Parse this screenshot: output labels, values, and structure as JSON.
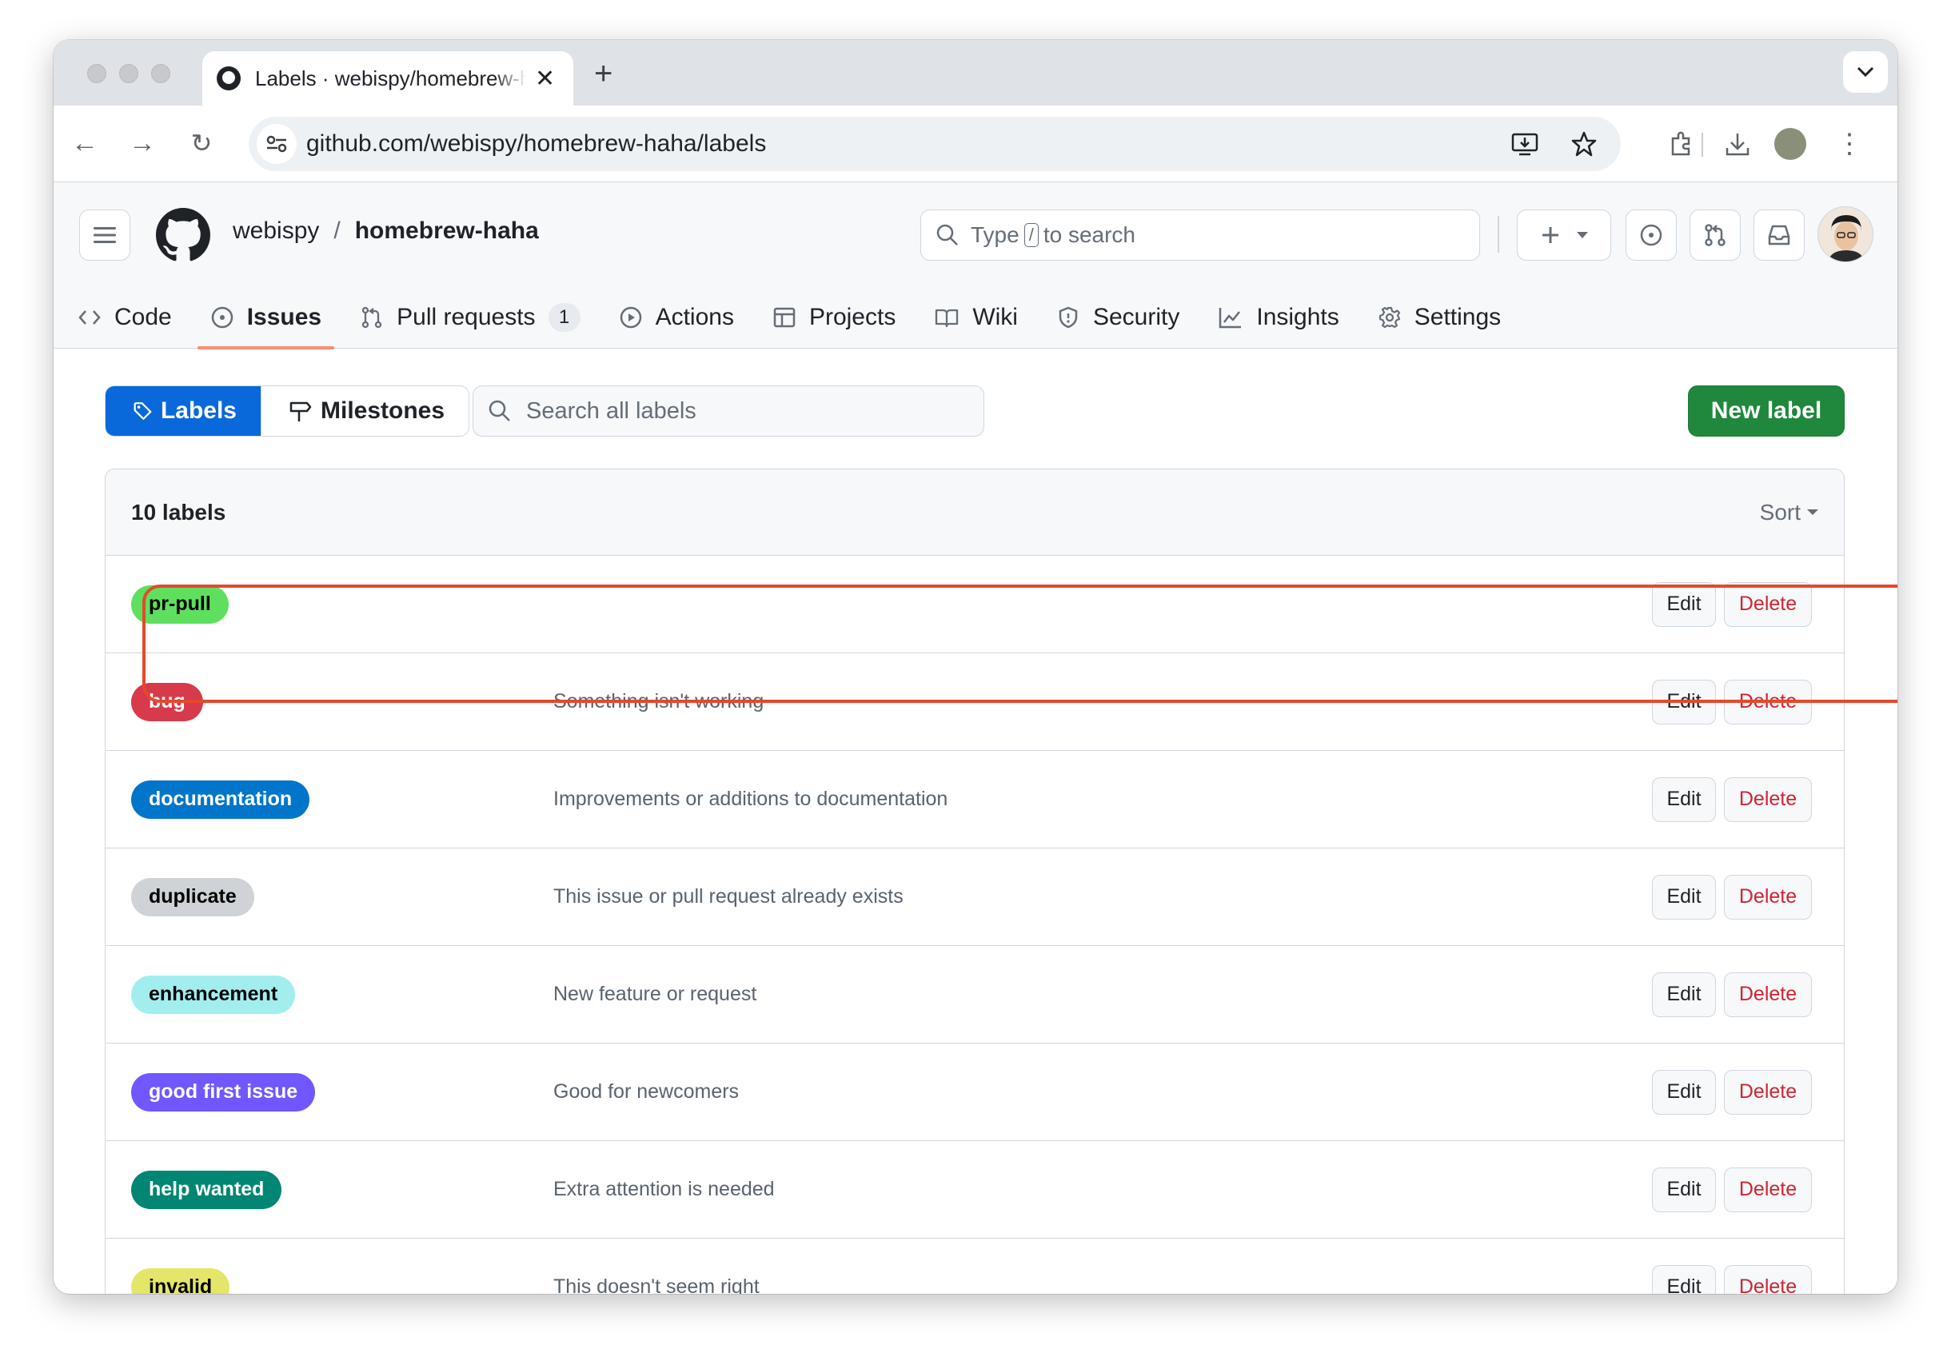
{
  "browser": {
    "tab_title": "Labels · webispy/homebrew-haha",
    "url": "github.com/webispy/homebrew-haha/labels"
  },
  "header": {
    "owner": "webispy",
    "separator": "/",
    "repo": "homebrew-haha",
    "search_prefix": "Type",
    "search_key": "/",
    "search_suffix": "to search"
  },
  "repo_nav": [
    {
      "label": "Code",
      "icon": "code-icon"
    },
    {
      "label": "Issues",
      "icon": "issue-icon",
      "selected": true
    },
    {
      "label": "Pull requests",
      "icon": "pull-request-icon",
      "count": "1"
    },
    {
      "label": "Actions",
      "icon": "play-icon"
    },
    {
      "label": "Projects",
      "icon": "table-icon"
    },
    {
      "label": "Wiki",
      "icon": "book-icon"
    },
    {
      "label": "Security",
      "icon": "shield-icon"
    },
    {
      "label": "Insights",
      "icon": "graph-icon"
    },
    {
      "label": "Settings",
      "icon": "gear-icon"
    }
  ],
  "subnav": {
    "labels": "Labels",
    "milestones": "Milestones",
    "search_placeholder": "Search all labels",
    "new_label": "New label"
  },
  "labels_box": {
    "count": "10 labels",
    "sort": "Sort",
    "edit": "Edit",
    "delete": "Delete",
    "rows": [
      {
        "name": "pr-pull",
        "description": "",
        "bg": "#5ee05e",
        "fg": "#000000"
      },
      {
        "name": "bug",
        "description": "Something isn't working",
        "bg": "#d73a4a",
        "fg": "#ffffff"
      },
      {
        "name": "documentation",
        "description": "Improvements or additions to documentation",
        "bg": "#0075ca",
        "fg": "#ffffff"
      },
      {
        "name": "duplicate",
        "description": "This issue or pull request already exists",
        "bg": "#cfd3d7",
        "fg": "#000000"
      },
      {
        "name": "enhancement",
        "description": "New feature or request",
        "bg": "#a2eeef",
        "fg": "#000000"
      },
      {
        "name": "good first issue",
        "description": "Good for newcomers",
        "bg": "#7057ff",
        "fg": "#ffffff"
      },
      {
        "name": "help wanted",
        "description": "Extra attention is needed",
        "bg": "#008672",
        "fg": "#ffffff"
      },
      {
        "name": "invalid",
        "description": "This doesn't seem right",
        "bg": "#e4e669",
        "fg": "#000000"
      }
    ]
  },
  "colors": {
    "accent_blue": "#0969da",
    "primary_green": "#1f883d",
    "danger_red": "#d1242f",
    "highlight": "#e5482a"
  }
}
